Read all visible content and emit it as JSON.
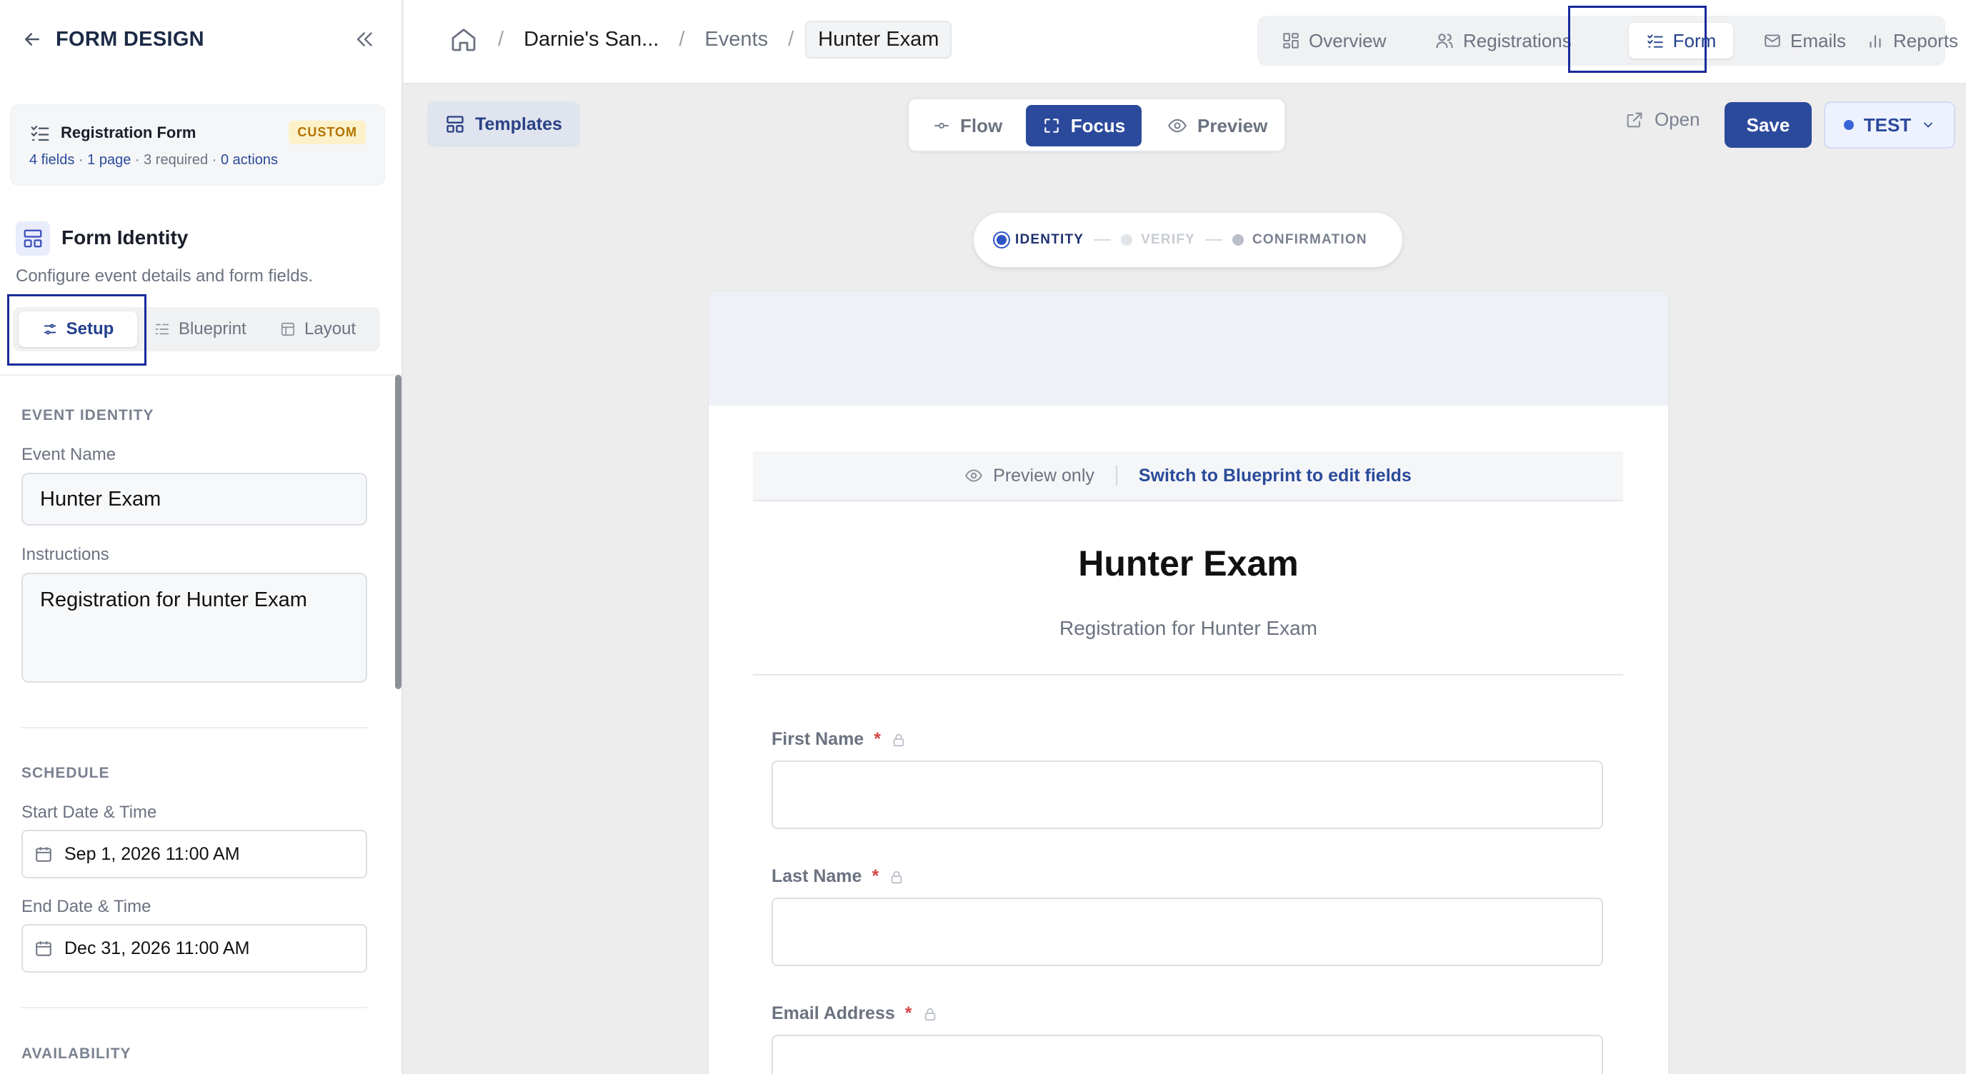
{
  "sidebar": {
    "title": "FORM DESIGN",
    "form_card": {
      "name": "Registration Form",
      "badge": "CUSTOM",
      "fields": "4 fields",
      "pages": "1 page",
      "required": "3 required",
      "actions": "0 actions",
      "sep": " · "
    },
    "section_title": "Form Identity",
    "section_desc": "Configure event details and form fields.",
    "tabs": [
      {
        "label": "Setup",
        "active": true
      },
      {
        "label": "Blueprint",
        "active": false
      },
      {
        "label": "Layout",
        "active": false
      }
    ],
    "event_identity": {
      "heading": "EVENT IDENTITY",
      "event_name_label": "Event Name",
      "event_name_value": "Hunter Exam",
      "instructions_label": "Instructions",
      "instructions_value": "Registration for Hunter Exam"
    },
    "schedule": {
      "heading": "SCHEDULE",
      "start_label": "Start Date & Time",
      "start_value": "Sep 1, 2026 11:00 AM",
      "end_label": "End Date & Time",
      "end_value": "Dec 31, 2026 11:00 AM"
    },
    "availability": {
      "heading": "AVAILABILITY"
    }
  },
  "header": {
    "breadcrumbs": [
      "Darnie's San...",
      "Events",
      "Hunter Exam"
    ],
    "tabs": [
      {
        "label": "Overview",
        "icon": "grid-icon",
        "active": false
      },
      {
        "label": "Registrations",
        "icon": "users-icon",
        "active": false
      },
      {
        "label": "Form",
        "icon": "list-check-icon",
        "active": true
      },
      {
        "label": "Emails",
        "icon": "mail-icon",
        "active": false
      },
      {
        "label": "Reports",
        "icon": "bar-chart-icon",
        "active": false
      }
    ]
  },
  "toolbar": {
    "templates_label": "Templates",
    "modes": [
      {
        "label": "Flow",
        "icon": "flow-icon",
        "active": false
      },
      {
        "label": "Focus",
        "icon": "focus-icon",
        "active": true
      },
      {
        "label": "Preview",
        "icon": "eye-icon",
        "active": false
      }
    ],
    "open_label": "Open",
    "save_label": "Save",
    "env_label": "TEST"
  },
  "steps": [
    {
      "label": "IDENTITY",
      "state": "current"
    },
    {
      "label": "VERIFY",
      "state": "disabled"
    },
    {
      "label": "CONFIRMATION",
      "state": "pending"
    }
  ],
  "canvas": {
    "preview_only": "Preview only",
    "switch_link": "Switch to Blueprint to edit fields",
    "form_title": "Hunter Exam",
    "form_subtitle": "Registration for Hunter Exam",
    "fields": [
      {
        "label": "First Name",
        "required": true,
        "locked": true
      },
      {
        "label": "Last Name",
        "required": true,
        "locked": true
      },
      {
        "label": "Email Address",
        "required": true,
        "locked": true
      }
    ],
    "required_mark": "*"
  },
  "colors": {
    "primary": "#2c4a9c",
    "highlight_box": "#1a2a9a",
    "required": "#d64545",
    "badge_bg": "#fdf1c9",
    "badge_text": "#b37400"
  }
}
